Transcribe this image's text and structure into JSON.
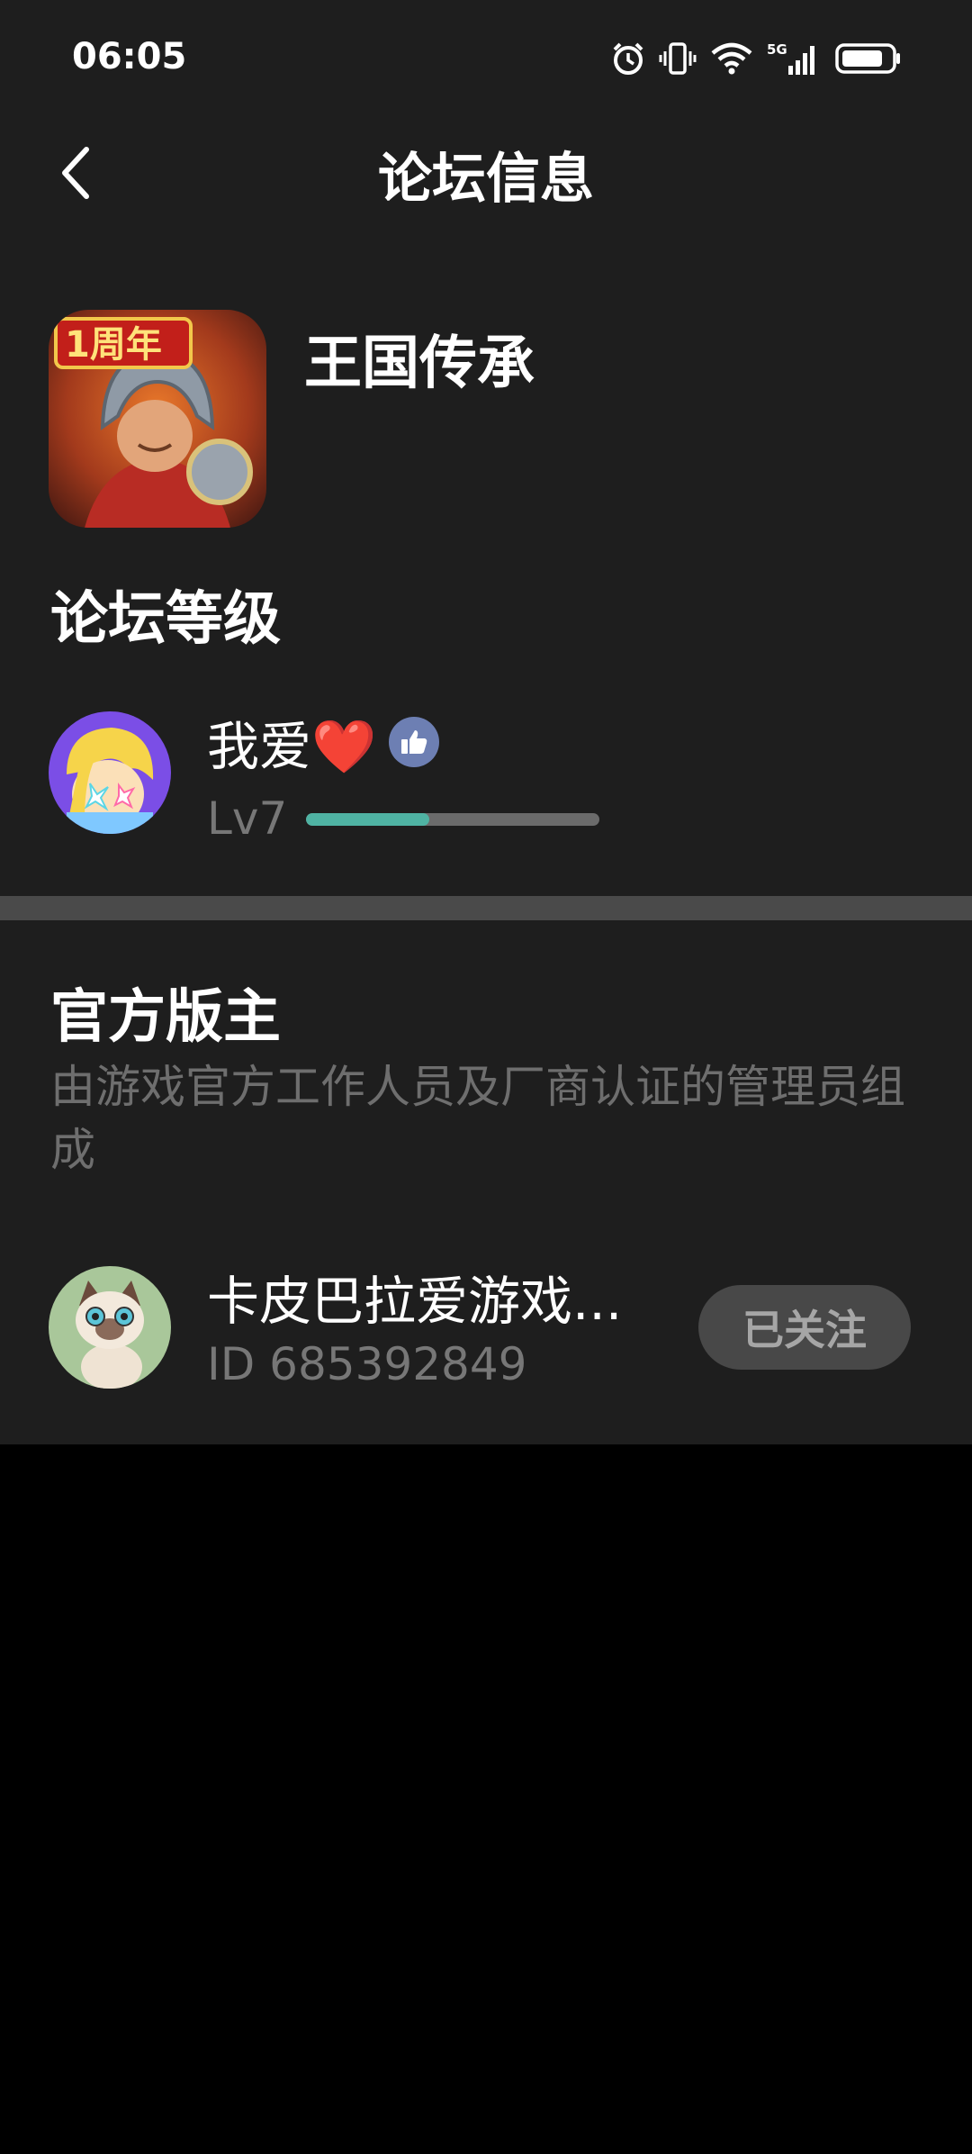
{
  "status_bar": {
    "time": "06:05",
    "battery_percent": 75,
    "network": "5G"
  },
  "header": {
    "title": "论坛信息"
  },
  "forum": {
    "name": "王国传承",
    "icon_badge_text": "1周年"
  },
  "level_section": {
    "title": "论坛等级",
    "user_name": "我爱❤️",
    "level": "Lv7",
    "progress": 0.42
  },
  "moderators": {
    "title": "官方版主",
    "description": "由游戏官方工作人员及厂商认证的管理员组成",
    "items": [
      {
        "name": "卡皮巴拉爱游戏...",
        "id": "ID 685392849",
        "follow_label": "已关注"
      }
    ]
  },
  "colors": {
    "panel": "#1e1e1e",
    "divider": "#4a4a4a",
    "progress": "#4fb3a3",
    "muted_text": "#777777"
  }
}
